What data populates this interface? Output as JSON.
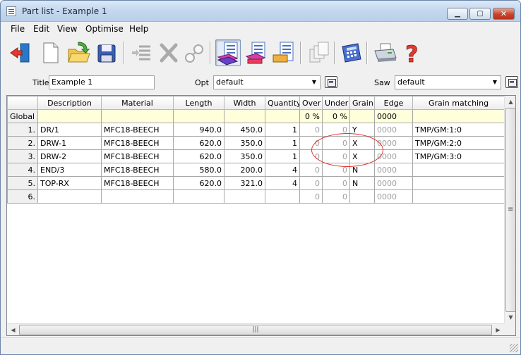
{
  "window": {
    "title": "Part list - Example 1",
    "min": "▁",
    "max": "▢",
    "close": "✕"
  },
  "menu": [
    "File",
    "Edit",
    "View",
    "Optimise",
    "Help"
  ],
  "form": {
    "title_label": "Title",
    "title_value": "Example 1",
    "opt_label": "Opt",
    "opt_value": "default",
    "saw_label": "Saw",
    "saw_value": "default"
  },
  "columns": [
    "",
    "Description",
    "Material",
    "Length",
    "Width",
    "Quantity",
    "Over",
    "Under",
    "Grain",
    "Edge",
    "Grain matching"
  ],
  "global_row": {
    "label": "Global",
    "over": "0 %",
    "under": "0 %",
    "edge": "0000"
  },
  "rows": [
    {
      "n": "1.",
      "desc": "DR/1",
      "mat": "MFC18-BEECH",
      "len": "940.0",
      "wid": "450.0",
      "qty": "1",
      "over": "0",
      "under": "0",
      "grain": "Y",
      "edge": "0000",
      "gm": "TMP/GM:1:0"
    },
    {
      "n": "2.",
      "desc": "DRW-1",
      "mat": "MFC18-BEECH",
      "len": "620.0",
      "wid": "350.0",
      "qty": "1",
      "over": "0",
      "under": "0",
      "grain": "X",
      "edge": "0000",
      "gm": "TMP/GM:2:0"
    },
    {
      "n": "3.",
      "desc": "DRW-2",
      "mat": "MFC18-BEECH",
      "len": "620.0",
      "wid": "350.0",
      "qty": "1",
      "over": "0",
      "under": "0",
      "grain": "X",
      "edge": "0000",
      "gm": "TMP/GM:3:0"
    },
    {
      "n": "4.",
      "desc": "END/3",
      "mat": "MFC18-BEECH",
      "len": "580.0",
      "wid": "200.0",
      "qty": "4",
      "over": "0",
      "under": "0",
      "grain": "N",
      "edge": "0000",
      "gm": ""
    },
    {
      "n": "5.",
      "desc": "TOP-RX",
      "mat": "MFC18-BEECH",
      "len": "620.0",
      "wid": "321.0",
      "qty": "4",
      "over": "0",
      "under": "0",
      "grain": "N",
      "edge": "0000",
      "gm": ""
    },
    {
      "n": "6.",
      "desc": "",
      "mat": "",
      "len": "",
      "wid": "",
      "qty": "",
      "over": "0",
      "under": "0",
      "grain": "",
      "edge": "0000",
      "gm": ""
    }
  ],
  "scroll": {
    "up": "▲",
    "down": "▼",
    "left": "◀",
    "right": "▶",
    "grip_v": "≡",
    "grip_h": "|||"
  },
  "colors": {
    "accent_red": "#e0302a",
    "global_row": "#ffffdc"
  },
  "toolbar_icons": [
    "exit-icon",
    "new-icon",
    "open-icon",
    "save-icon",
    "list-icon",
    "cut-icon",
    "link-icon",
    "parts-list-icon",
    "edit-list-icon",
    "board-list-icon",
    "copy-icon",
    "calculator-icon",
    "print-icon",
    "help-icon"
  ]
}
